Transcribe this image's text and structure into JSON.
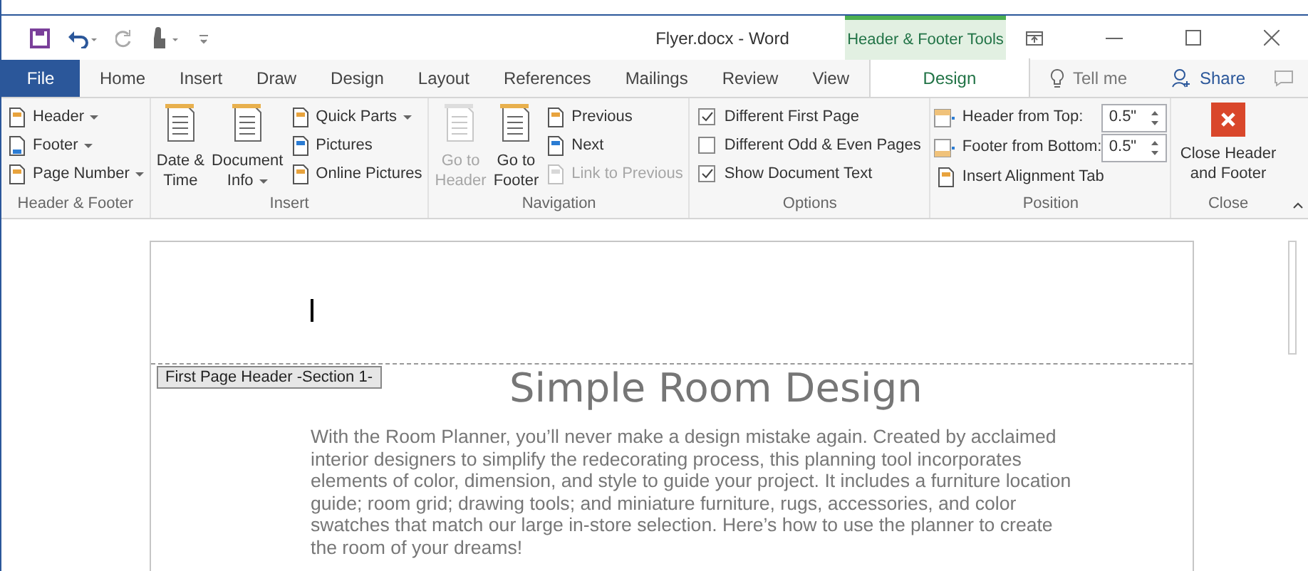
{
  "window": {
    "title": "Flyer.docx - Word"
  },
  "contextual_group": "Header & Footer Tools",
  "tabs": [
    {
      "label": "File",
      "kind": "file",
      "selected": false
    },
    {
      "label": "Home",
      "kind": "normal",
      "selected": false
    },
    {
      "label": "Insert",
      "kind": "normal",
      "selected": false
    },
    {
      "label": "Draw",
      "kind": "normal",
      "selected": false
    },
    {
      "label": "Design",
      "kind": "normal",
      "selected": false
    },
    {
      "label": "Layout",
      "kind": "normal",
      "selected": false
    },
    {
      "label": "References",
      "kind": "normal",
      "selected": false
    },
    {
      "label": "Mailings",
      "kind": "normal",
      "selected": false
    },
    {
      "label": "Review",
      "kind": "normal",
      "selected": false
    },
    {
      "label": "View",
      "kind": "normal",
      "selected": false
    },
    {
      "label": "Design",
      "kind": "contextual",
      "selected": true
    }
  ],
  "tell_me": {
    "placeholder": "Tell me"
  },
  "share": "Share",
  "groups": [
    {
      "label": "Header & Footer",
      "columns": [
        [
          {
            "kind": "small",
            "label": "Header",
            "dropdown": true,
            "disabled": false
          },
          {
            "kind": "small",
            "label": "Footer",
            "dropdown": true,
            "disabled": false
          },
          {
            "kind": "small",
            "label": "Page Number",
            "dropdown": true,
            "disabled": false
          }
        ]
      ]
    },
    {
      "label": "Insert",
      "columns": [
        [
          {
            "kind": "large",
            "lines": [
              "Date &",
              "Time"
            ],
            "dropdown": false,
            "disabled": false
          }
        ],
        [
          {
            "kind": "large",
            "lines": [
              "Document",
              "Info"
            ],
            "dropdown": true,
            "disabled": false
          }
        ],
        [
          {
            "kind": "small",
            "label": "Quick Parts",
            "dropdown": true,
            "disabled": false
          },
          {
            "kind": "small",
            "label": "Pictures",
            "dropdown": false,
            "disabled": false
          },
          {
            "kind": "small",
            "label": "Online Pictures",
            "dropdown": false,
            "disabled": false
          }
        ]
      ]
    },
    {
      "label": "Navigation",
      "columns": [
        [
          {
            "kind": "large",
            "lines": [
              "Go to",
              "Header"
            ],
            "dropdown": false,
            "disabled": true
          }
        ],
        [
          {
            "kind": "large",
            "lines": [
              "Go to",
              "Footer"
            ],
            "dropdown": false,
            "disabled": false
          }
        ],
        [
          {
            "kind": "small",
            "label": "Previous",
            "dropdown": false,
            "disabled": false
          },
          {
            "kind": "small",
            "label": "Next",
            "dropdown": false,
            "disabled": false
          },
          {
            "kind": "small",
            "label": "Link to Previous",
            "dropdown": false,
            "disabled": true
          }
        ]
      ]
    },
    {
      "label": "Options",
      "columns": [
        [
          {
            "kind": "checkbox",
            "label": "Different First Page",
            "checked": true
          },
          {
            "kind": "checkbox",
            "label": "Different Odd & Even Pages",
            "checked": false
          },
          {
            "kind": "checkbox",
            "label": "Show Document Text",
            "checked": true
          }
        ]
      ]
    },
    {
      "label": "Position",
      "columns": [
        [
          {
            "kind": "spinner",
            "label": "Header from Top:",
            "value": "0.5\""
          },
          {
            "kind": "spinner",
            "label": "Footer from Bottom:",
            "value": "0.5\""
          },
          {
            "kind": "small",
            "label": "Insert Alignment Tab",
            "dropdown": false,
            "disabled": false
          }
        ]
      ]
    },
    {
      "label": "Close",
      "columns": [
        [
          {
            "kind": "close",
            "lines": [
              "Close Header",
              "and Footer"
            ]
          }
        ]
      ]
    }
  ],
  "document": {
    "header_tag": "First Page Header -Section 1-",
    "title": "Simple Room Design",
    "paragraph": "With the Room Planner, you’ll never make a design mistake again. Created by acclaimed interior designers to simplify the redecorating process, this planning tool incorporates elements of color, dimension, and style to guide your project. It includes a furniture location guide; room grid; drawing tools; and miniature furniture, rugs, accessories, and color swatches that match our large in-store selection. Here’s how to use the planner to create the room of your dreams!"
  }
}
